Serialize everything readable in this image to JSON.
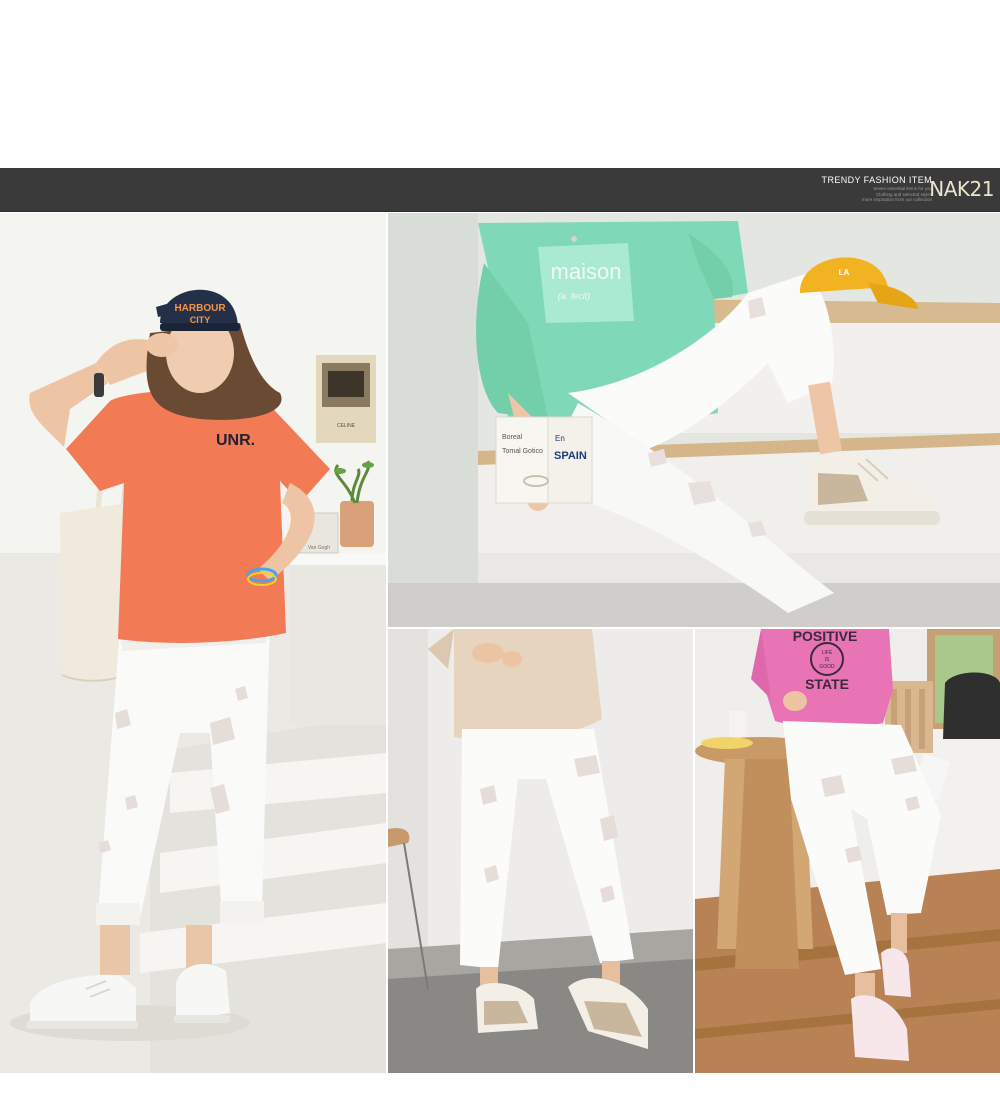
{
  "banner": {
    "title": "TRENDY FASHION ITEM",
    "subtitle_lines": [
      "Seven essential items for you",
      "Clothing and selected styles",
      "more inspiration from our collection"
    ],
    "brand": "NAK21"
  },
  "photos": {
    "left": {
      "cap_text_line1": "HARBOUR",
      "cap_text_line2": "CITY",
      "shirt_text": "UNR.",
      "poster_caption": "CELINE",
      "frame_caption": "Van Gogh"
    },
    "right_top": {
      "sweatshirt_text": "maison",
      "sweatshirt_subtext": "(a. fecit)",
      "book_title": "SPAIN",
      "book_title_prefix": "En",
      "book_side_text1": "Boreal",
      "book_side_text2": "Tomal Gotico",
      "cap_logo": "LA"
    },
    "bottom_right": {
      "sweatshirt_text_top": "POSITIVE",
      "badge_line1": "LIFE",
      "badge_line2": "IS",
      "badge_line3": "GOOD",
      "sweatshirt_text_bottom": "STATE"
    }
  },
  "colors": {
    "banner_bg": "#3a3a3a",
    "brand_color": "#e9e4cf",
    "orange_tee": "#f27a55",
    "mint_sweatshirt": "#7fd9b6",
    "pink_sweatshirt": "#e874b6",
    "mustard_cap": "#f2b322",
    "navy_cap": "#243047"
  }
}
